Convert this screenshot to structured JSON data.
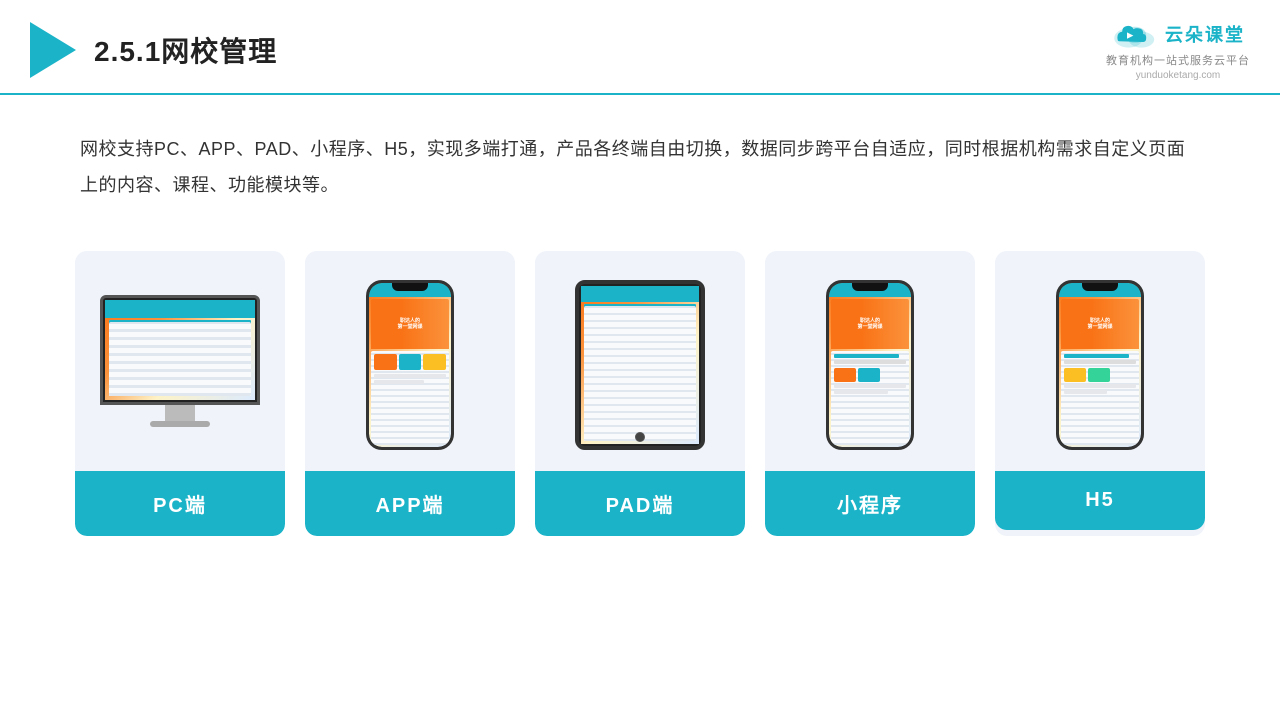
{
  "header": {
    "title": "2.5.1网校管理",
    "brand": "云朵课堂",
    "brand_sub": "教育机构一站\n式服务云平台",
    "brand_url": "yunduoketang.com"
  },
  "description": {
    "text": "网校支持PC、APP、PAD、小程序、H5，实现多端打通，产品各终端自由切换，数据同步跨平台自适应，同时根据机构需求自定义页面上的内容、课程、功能模块等。"
  },
  "cards": [
    {
      "id": "pc",
      "label": "PC端",
      "type": "pc"
    },
    {
      "id": "app",
      "label": "APP端",
      "type": "phone"
    },
    {
      "id": "pad",
      "label": "PAD端",
      "type": "tablet"
    },
    {
      "id": "miniprogram",
      "label": "小程序",
      "type": "phone"
    },
    {
      "id": "h5",
      "label": "H5",
      "type": "phone"
    }
  ]
}
